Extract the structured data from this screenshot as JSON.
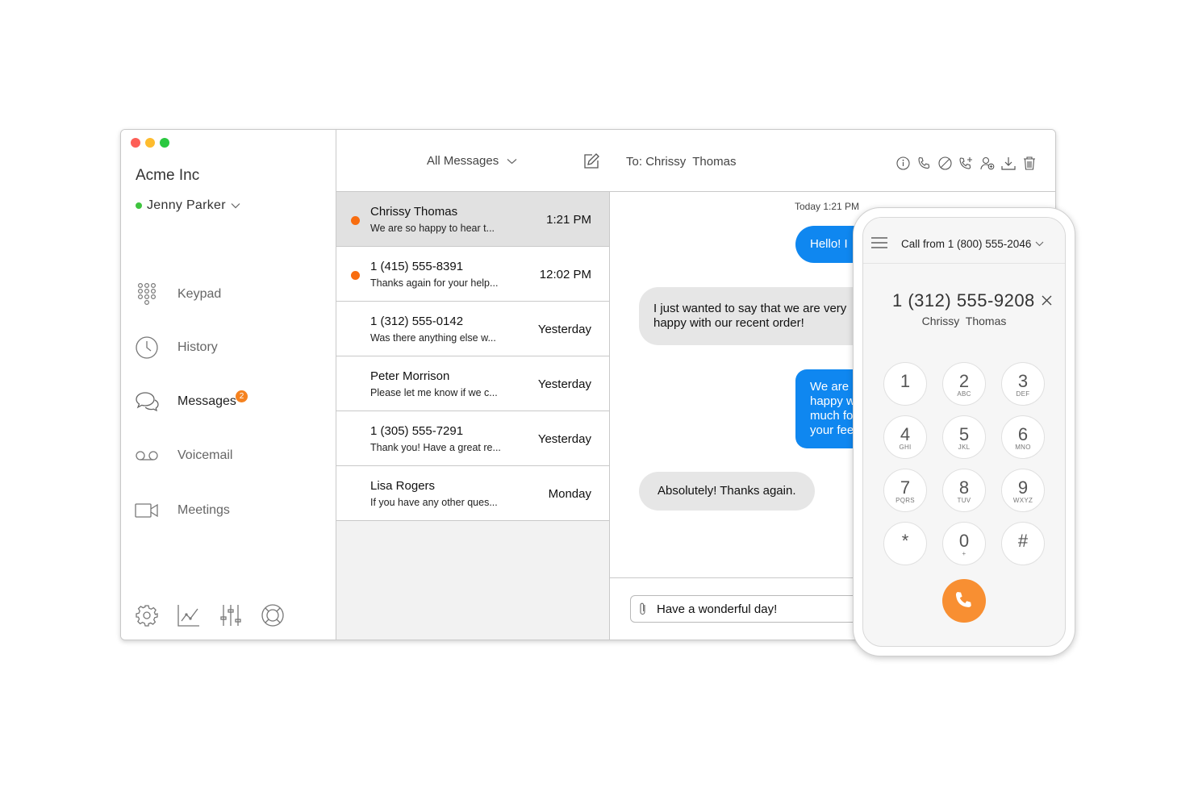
{
  "colors": {
    "accent": "#0f87f0",
    "unread": "#f86d10",
    "call": "#f88f32",
    "online": "#3ec43e",
    "badge": "#f5821f"
  },
  "sidebar": {
    "company": "Acme Inc",
    "user": "Jenny Parker",
    "nav": [
      {
        "label": "Keypad",
        "icon": "keypad-icon"
      },
      {
        "label": "History",
        "icon": "clock-icon"
      },
      {
        "label": "Messages",
        "icon": "chat-bubbles-icon",
        "badge": "2"
      },
      {
        "label": "Voicemail",
        "icon": "voicemail-icon"
      },
      {
        "label": "Meetings",
        "icon": "video-camera-icon"
      }
    ],
    "bottom_icons": [
      "gear-icon",
      "chart-icon",
      "sliders-icon",
      "lifebuoy-icon"
    ]
  },
  "toolbar": {
    "filter": "All Messages",
    "to_label": "To:",
    "to_name": "Chrissy  Thomas",
    "actions": [
      "info-icon",
      "phone-icon",
      "block-icon",
      "call-add-icon",
      "add-contact-icon",
      "download-icon",
      "trash-icon"
    ]
  },
  "conversations": [
    {
      "name": "Chrissy Thomas",
      "preview": "We are so happy to hear t...",
      "time": "1:21 PM",
      "unread": true,
      "active": true
    },
    {
      "name": "1 (415) 555-8391",
      "preview": "Thanks again for your help...",
      "time": "12:02 PM",
      "unread": true,
      "active": false
    },
    {
      "name": "1 (312) 555-0142",
      "preview": "Was there anything else w...",
      "time": "Yesterday",
      "unread": false,
      "active": false
    },
    {
      "name": "Peter Morrison",
      "preview": "Please let me know if we c...",
      "time": "Yesterday",
      "unread": false,
      "active": false
    },
    {
      "name": "1 (305) 555-7291",
      "preview": "Thank you! Have a great re...",
      "time": "Yesterday",
      "unread": false,
      "active": false
    },
    {
      "name": "Lisa Rogers",
      "preview": "If you have any other ques...",
      "time": "Monday",
      "unread": false,
      "active": false
    }
  ],
  "thread": {
    "timestamp": "Today 1:21 PM",
    "messages": [
      {
        "dir": "out",
        "lines": [
          "Hello! I"
        ]
      },
      {
        "dir": "in",
        "lines": [
          "I just wanted to say that we are very",
          "happy with our recent order!"
        ]
      },
      {
        "dir": "out",
        "lines": [
          "We are",
          "happy w",
          "much fo",
          "your fee"
        ]
      },
      {
        "dir": "in",
        "lines": [
          "Absolutely! Thanks again."
        ]
      }
    ],
    "composer_value": "Have a wonderful day!"
  },
  "phone": {
    "call_from": "Call from 1 (800) 555-2046",
    "number": "1 (312) 555-9208",
    "name": "Chrissy  Thomas",
    "keys": [
      {
        "d": "1",
        "l": ""
      },
      {
        "d": "2",
        "l": "ABC"
      },
      {
        "d": "3",
        "l": "DEF"
      },
      {
        "d": "4",
        "l": "GHI"
      },
      {
        "d": "5",
        "l": "JKL"
      },
      {
        "d": "6",
        "l": "MNO"
      },
      {
        "d": "7",
        "l": "PQRS"
      },
      {
        "d": "8",
        "l": "TUV"
      },
      {
        "d": "9",
        "l": "WXYZ"
      },
      {
        "d": "*",
        "l": ""
      },
      {
        "d": "0",
        "l": "+"
      },
      {
        "d": "#",
        "l": ""
      }
    ]
  }
}
